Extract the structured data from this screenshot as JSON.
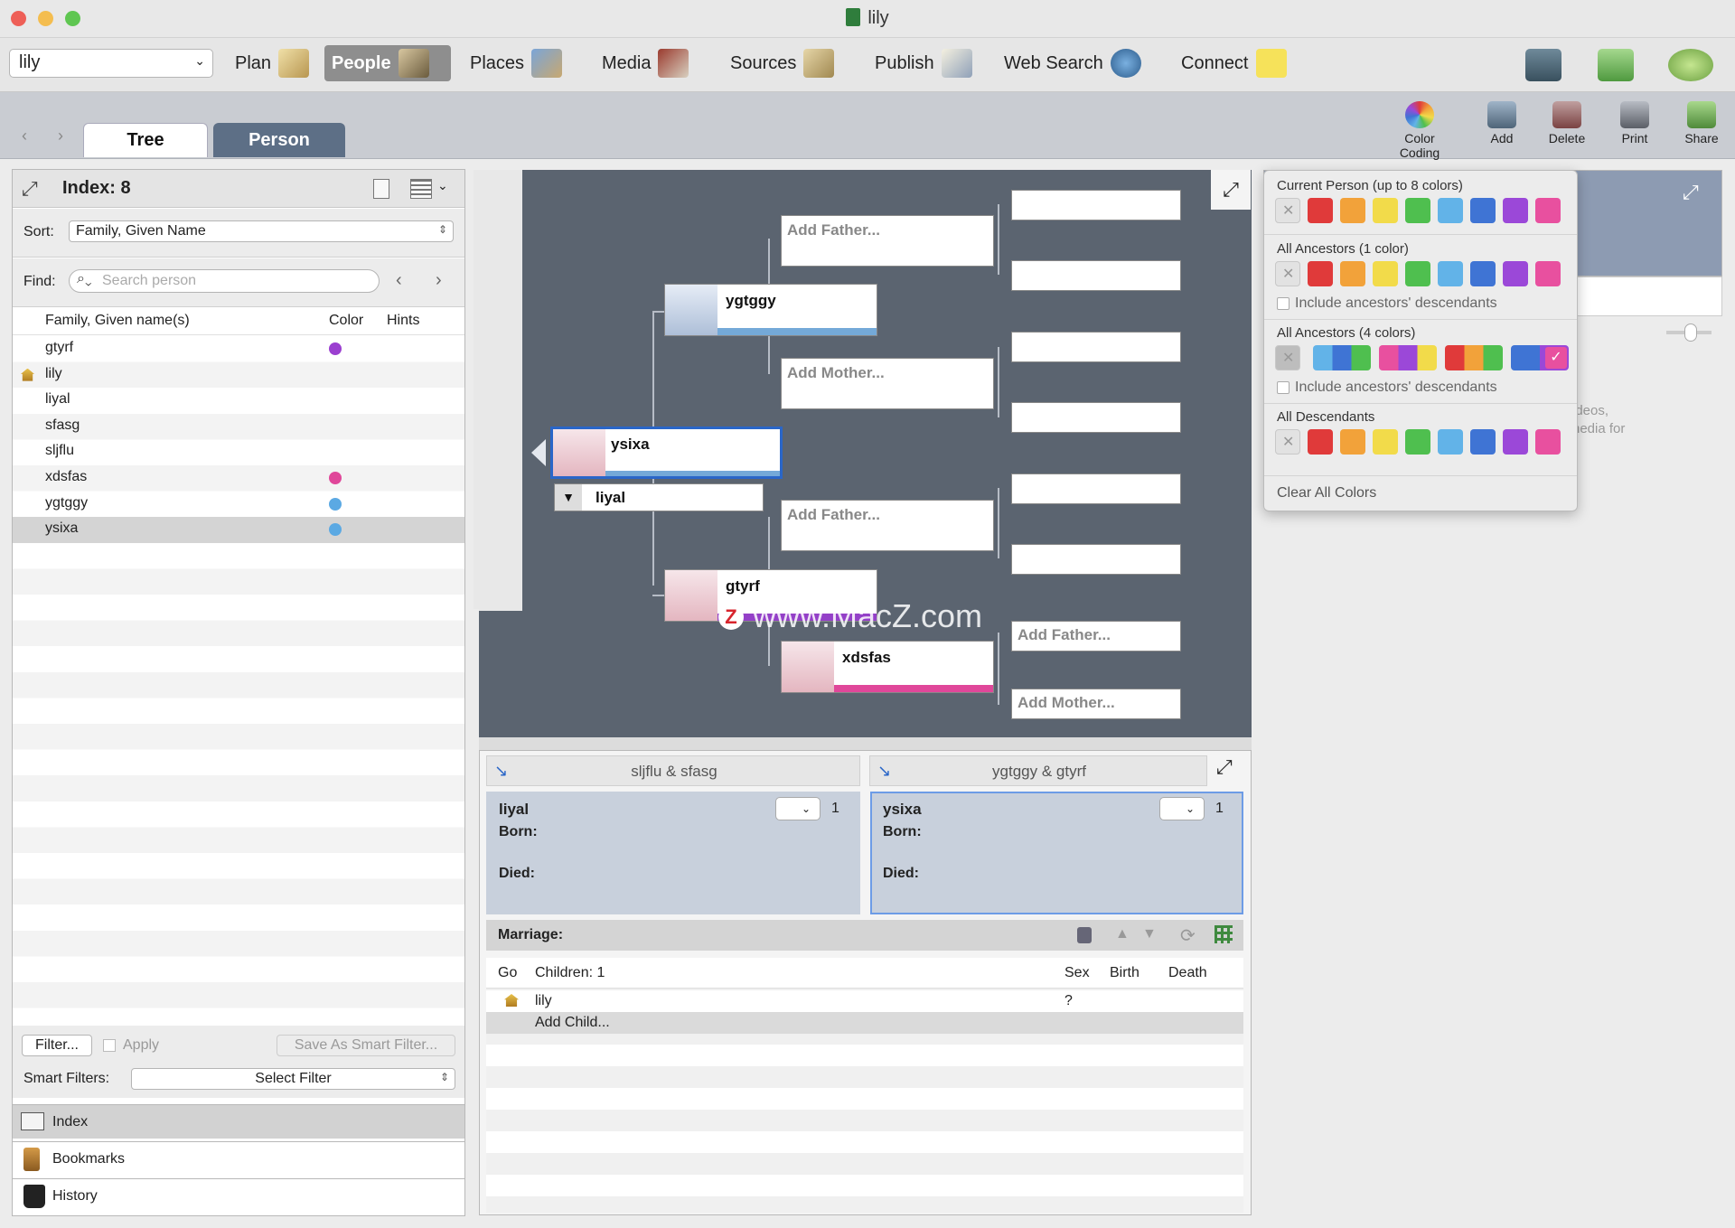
{
  "window": {
    "title": "lily"
  },
  "toolbar": {
    "person_select": "lily",
    "plan": "Plan",
    "people": "People",
    "places": "Places",
    "media": "Media",
    "sources": "Sources",
    "publish": "Publish",
    "web_search": "Web Search",
    "connect": "Connect"
  },
  "tabs": {
    "tree": "Tree",
    "person": "Person"
  },
  "actions": {
    "color_coding": "Color Coding",
    "add": "Add",
    "delete": "Delete",
    "print": "Print",
    "share": "Share"
  },
  "index": {
    "title": "Index: 8",
    "sort_label": "Sort:",
    "sort_value": "Family, Given Name",
    "find_label": "Find:",
    "search_placeholder": "Search person",
    "col_name": "Family, Given name(s)",
    "col_color": "Color",
    "col_hints": "Hints",
    "rows": [
      {
        "name": "gtyrf",
        "color": "#9b3fd0"
      },
      {
        "name": "lily",
        "color": ""
      },
      {
        "name": "liyal",
        "color": ""
      },
      {
        "name": "sfasg",
        "color": ""
      },
      {
        "name": "sljflu",
        "color": ""
      },
      {
        "name": "xdsfas",
        "color": "#e0479a"
      },
      {
        "name": "ygtggy",
        "color": "#5ba9e3"
      },
      {
        "name": "ysixa",
        "color": "#5ba9e3"
      }
    ],
    "filter_btn": "Filter...",
    "apply": "Apply",
    "save_smart": "Save As Smart Filter...",
    "smart_label": "Smart Filters:",
    "smart_value": "Select Filter"
  },
  "sidebar_bottom": {
    "index": "Index",
    "bookmarks": "Bookmarks",
    "history": "History"
  },
  "tree": {
    "root": "ysixa",
    "spouse": "liyal",
    "father": "ygtggy",
    "mother": "gtyrf",
    "mgm": "xdsfas",
    "add_father": "Add Father...",
    "add_mother": "Add Mother..."
  },
  "watermark": "www.MacZ.com",
  "family": {
    "left_title": "sljflu & sfasg",
    "right_title": "ygtggy & gtyrf",
    "left_name": "liyal",
    "right_name": "ysixa",
    "count_left": "1",
    "count_right": "1",
    "born": "Born:",
    "died": "Died:",
    "marriage": "Marriage:",
    "col_go": "Go",
    "col_children": "Children: 1",
    "col_sex": "Sex",
    "col_birth": "Birth",
    "col_death": "Death",
    "child_name": "lily",
    "child_sex": "?",
    "add_child": "Add Child..."
  },
  "popover": {
    "current": "Current Person (up to 8 colors)",
    "ancestors1": "All Ancestors (1 color)",
    "include1": "Include ancestors' descendants",
    "ancestors4": "All Ancestors (4 colors)",
    "include4": "Include ancestors' descendants",
    "descendants": "All Descendants",
    "clear": "Clear All Colors",
    "colors": [
      "#e03a3a",
      "#f2a23a",
      "#f2db4a",
      "#4fbf4f",
      "#62b3e8",
      "#3f74d4",
      "#9b48d8",
      "#e8509f"
    ]
  },
  "right_fragment": {
    "line1": "ideos,",
    "line2": "nedia for"
  }
}
